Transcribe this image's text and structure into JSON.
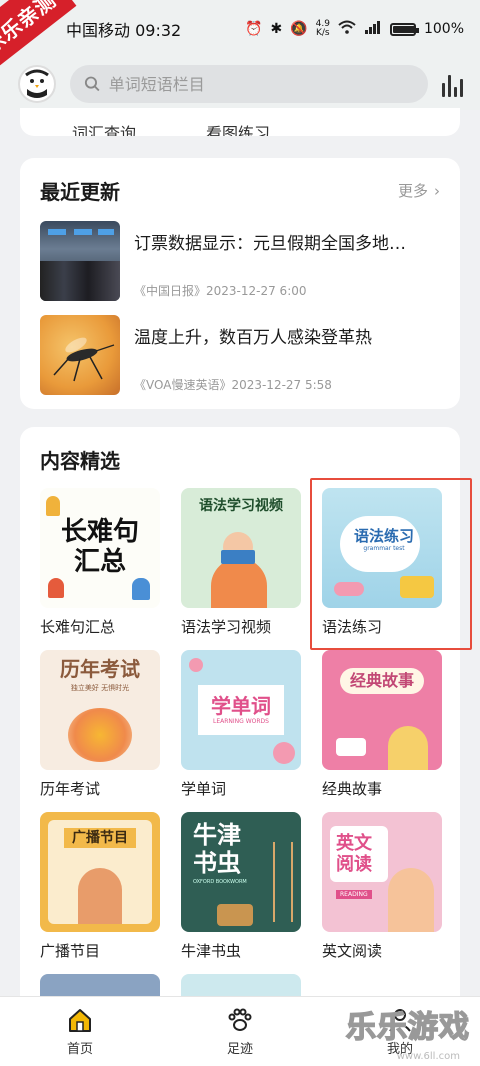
{
  "watermark": {
    "corner": "乐乐亲测",
    "bottom": "乐乐游戏",
    "url": "www.6ll.com"
  },
  "status": {
    "carrier_time": "中国移动 09:32",
    "net_speed_value": "4.9",
    "net_speed_unit": "K/s",
    "battery": "100%"
  },
  "search": {
    "placeholder": "单词短语栏目"
  },
  "top_links": [
    "词汇查询",
    "看图练习"
  ],
  "recent": {
    "title": "最近更新",
    "more": "更多",
    "items": [
      {
        "title": "订票数据显示：元旦假期全国多地…",
        "source": "《中国日报》2023-12-27 6:00"
      },
      {
        "title": "温度上升，数百万人感染登革热",
        "source": "《VOA慢速英语》2023-12-27 5:58"
      }
    ]
  },
  "featured": {
    "title": "内容精选",
    "items": [
      {
        "label": "长难句汇总",
        "cover": "长难句\n汇总"
      },
      {
        "label": "语法学习视频",
        "cover": "语法学习视频"
      },
      {
        "label": "语法练习",
        "cover": "语法练习",
        "cover_sub": "grammar test"
      },
      {
        "label": "历年考试",
        "cover": "历年考试",
        "cover_sub": "独立美好 无惧时光"
      },
      {
        "label": "学单词",
        "cover": "学单词",
        "cover_sub": "LEARNING WORDS"
      },
      {
        "label": "经典故事",
        "cover": "经典故事"
      },
      {
        "label": "广播节目",
        "cover": "广播节目"
      },
      {
        "label": "牛津书虫",
        "cover": "牛津\n书虫",
        "cover_sub": "OXFORD BOOKWORM"
      },
      {
        "label": "英文阅读",
        "cover": "英文\n阅读",
        "cover_sub": "READING"
      }
    ]
  },
  "nav": {
    "home": "首页",
    "footprint": "足迹",
    "mine": "我的"
  },
  "colors": {
    "highlight": "#e74c3c",
    "nav_active": "#f2b705"
  }
}
